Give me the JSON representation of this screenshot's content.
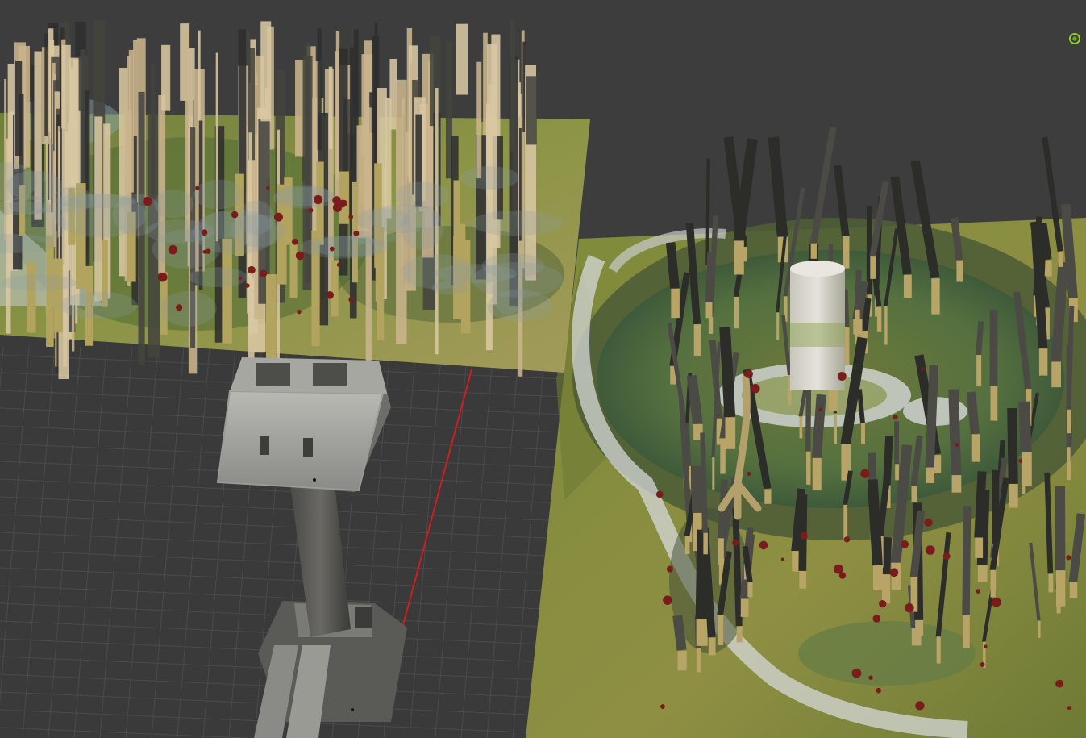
{
  "app": {
    "name": "3D Viewport"
  },
  "viewport": {
    "background": "#3d3d3d",
    "grid_line_color": "#4a4a4a",
    "grid_floor_color": "#3a3a3a",
    "x_axis_color": "#d01e1e",
    "gizmo_color": "#8fcf2a"
  },
  "scene": {
    "objects": [
      "terrain-plane-left",
      "forest-trees-left",
      "tower-structure",
      "terrain-plane-right",
      "circular-swamp-island",
      "cylinder-pillars-right"
    ],
    "colors": {
      "terrain": "#7d8a3c",
      "terrain_dark": "#5e6b2a",
      "bark_light": "#c9b48c",
      "bark_dark": "#2f2f2f",
      "water": "#4f6a4a",
      "snow": "#d6d8d8",
      "tower_grey": "#8b8b88",
      "red_flowers": "#7a1c1c"
    }
  }
}
